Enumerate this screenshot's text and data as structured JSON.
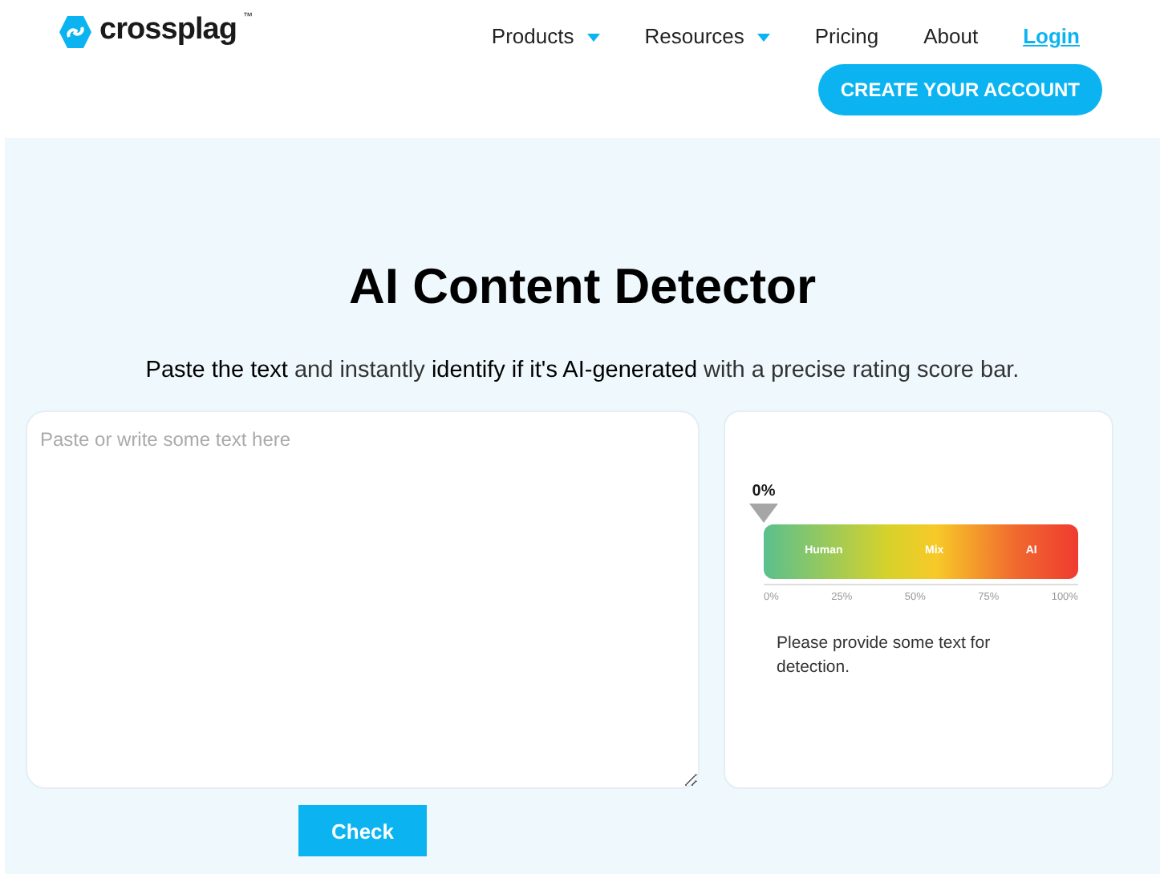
{
  "header": {
    "logo": "crossplag",
    "logo_mark": "™",
    "nav": [
      {
        "label": "Products",
        "kind": "dropdown"
      },
      {
        "label": "Resources",
        "kind": "dropdown"
      },
      {
        "label": "Pricing",
        "kind": "link"
      },
      {
        "label": "About",
        "kind": "link"
      },
      {
        "label": "Login",
        "kind": "login"
      }
    ],
    "cta": "CREATE YOUR ACCOUNT"
  },
  "hero": {
    "title": "AI Content Detector",
    "subtitle": "**Paste the text** and instantly **identify if it's AI-generated** with a precise rating score bar."
  },
  "input": {
    "placeholder": "Paste or write some text here"
  },
  "check_button": "Check",
  "result": {
    "score": "0%",
    "bands": [
      "Human",
      "Mix",
      "AI"
    ],
    "ticks": [
      "0%",
      "25%",
      "50%",
      "75%",
      "100%"
    ],
    "message": "Please provide some text for detection."
  }
}
